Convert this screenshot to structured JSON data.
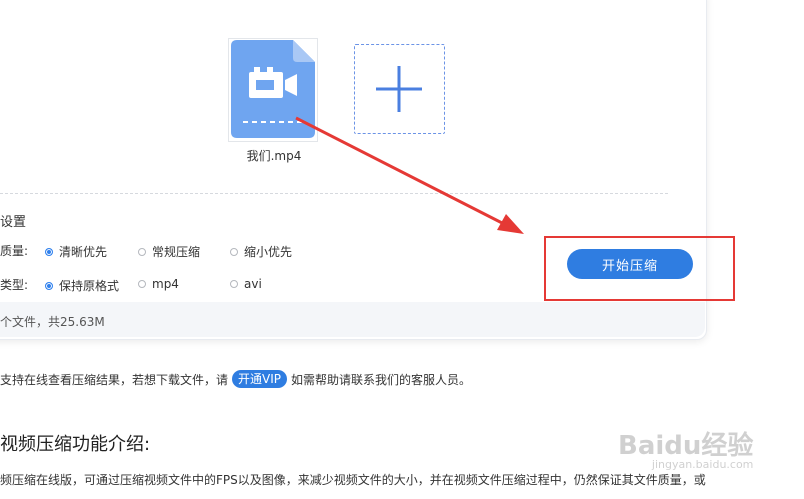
{
  "file": {
    "name": "我们.mp4",
    "icon": "video-file-icon"
  },
  "add_button": {
    "icon": "plus-icon"
  },
  "settings": {
    "title": "设置",
    "quality": {
      "label": "质量:",
      "options": [
        "清晰优先",
        "常规压缩",
        "缩小优先"
      ],
      "selected": "清晰优先"
    },
    "format": {
      "label": "类型:",
      "options": [
        "保持原格式",
        "mp4",
        "avi"
      ],
      "selected": "保持原格式"
    }
  },
  "summary": "个文件，共25.63M",
  "start_button": {
    "label": "开始压缩"
  },
  "notice": {
    "before": "支持在线查看压缩结果，若想下载文件，请",
    "vip_label": "开通VIP",
    "after": "如需帮助请联系我们的客服人员。"
  },
  "intro": {
    "title": "视频压缩功能介绍:",
    "text": "频压缩在线版，可通过压缩视频文件中的FPS以及图像，来减少视频文件的大小，并在视频文件压缩过程中，仍然保证其文件质量，或"
  },
  "watermark": {
    "text": "Baidu经验",
    "sub": "jingyan.baidu.com"
  },
  "colors": {
    "accent": "#2f7de1",
    "annotation": "#e53935",
    "file_icon": "#6fa5f0"
  }
}
